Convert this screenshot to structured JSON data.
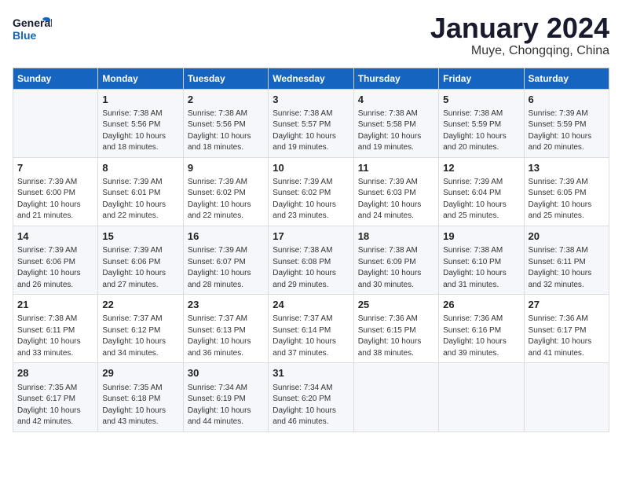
{
  "header": {
    "logo_general": "General",
    "logo_blue": "Blue",
    "month_title": "January 2024",
    "location": "Muye, Chongqing, China"
  },
  "weekdays": [
    "Sunday",
    "Monday",
    "Tuesday",
    "Wednesday",
    "Thursday",
    "Friday",
    "Saturday"
  ],
  "weeks": [
    [
      {
        "day": "",
        "sunrise": "",
        "sunset": "",
        "daylight": ""
      },
      {
        "day": "1",
        "sunrise": "Sunrise: 7:38 AM",
        "sunset": "Sunset: 5:56 PM",
        "daylight": "Daylight: 10 hours and 18 minutes."
      },
      {
        "day": "2",
        "sunrise": "Sunrise: 7:38 AM",
        "sunset": "Sunset: 5:56 PM",
        "daylight": "Daylight: 10 hours and 18 minutes."
      },
      {
        "day": "3",
        "sunrise": "Sunrise: 7:38 AM",
        "sunset": "Sunset: 5:57 PM",
        "daylight": "Daylight: 10 hours and 19 minutes."
      },
      {
        "day": "4",
        "sunrise": "Sunrise: 7:38 AM",
        "sunset": "Sunset: 5:58 PM",
        "daylight": "Daylight: 10 hours and 19 minutes."
      },
      {
        "day": "5",
        "sunrise": "Sunrise: 7:38 AM",
        "sunset": "Sunset: 5:59 PM",
        "daylight": "Daylight: 10 hours and 20 minutes."
      },
      {
        "day": "6",
        "sunrise": "Sunrise: 7:39 AM",
        "sunset": "Sunset: 5:59 PM",
        "daylight": "Daylight: 10 hours and 20 minutes."
      }
    ],
    [
      {
        "day": "7",
        "sunrise": "Sunrise: 7:39 AM",
        "sunset": "Sunset: 6:00 PM",
        "daylight": "Daylight: 10 hours and 21 minutes."
      },
      {
        "day": "8",
        "sunrise": "Sunrise: 7:39 AM",
        "sunset": "Sunset: 6:01 PM",
        "daylight": "Daylight: 10 hours and 22 minutes."
      },
      {
        "day": "9",
        "sunrise": "Sunrise: 7:39 AM",
        "sunset": "Sunset: 6:02 PM",
        "daylight": "Daylight: 10 hours and 22 minutes."
      },
      {
        "day": "10",
        "sunrise": "Sunrise: 7:39 AM",
        "sunset": "Sunset: 6:02 PM",
        "daylight": "Daylight: 10 hours and 23 minutes."
      },
      {
        "day": "11",
        "sunrise": "Sunrise: 7:39 AM",
        "sunset": "Sunset: 6:03 PM",
        "daylight": "Daylight: 10 hours and 24 minutes."
      },
      {
        "day": "12",
        "sunrise": "Sunrise: 7:39 AM",
        "sunset": "Sunset: 6:04 PM",
        "daylight": "Daylight: 10 hours and 25 minutes."
      },
      {
        "day": "13",
        "sunrise": "Sunrise: 7:39 AM",
        "sunset": "Sunset: 6:05 PM",
        "daylight": "Daylight: 10 hours and 25 minutes."
      }
    ],
    [
      {
        "day": "14",
        "sunrise": "Sunrise: 7:39 AM",
        "sunset": "Sunset: 6:06 PM",
        "daylight": "Daylight: 10 hours and 26 minutes."
      },
      {
        "day": "15",
        "sunrise": "Sunrise: 7:39 AM",
        "sunset": "Sunset: 6:06 PM",
        "daylight": "Daylight: 10 hours and 27 minutes."
      },
      {
        "day": "16",
        "sunrise": "Sunrise: 7:39 AM",
        "sunset": "Sunset: 6:07 PM",
        "daylight": "Daylight: 10 hours and 28 minutes."
      },
      {
        "day": "17",
        "sunrise": "Sunrise: 7:38 AM",
        "sunset": "Sunset: 6:08 PM",
        "daylight": "Daylight: 10 hours and 29 minutes."
      },
      {
        "day": "18",
        "sunrise": "Sunrise: 7:38 AM",
        "sunset": "Sunset: 6:09 PM",
        "daylight": "Daylight: 10 hours and 30 minutes."
      },
      {
        "day": "19",
        "sunrise": "Sunrise: 7:38 AM",
        "sunset": "Sunset: 6:10 PM",
        "daylight": "Daylight: 10 hours and 31 minutes."
      },
      {
        "day": "20",
        "sunrise": "Sunrise: 7:38 AM",
        "sunset": "Sunset: 6:11 PM",
        "daylight": "Daylight: 10 hours and 32 minutes."
      }
    ],
    [
      {
        "day": "21",
        "sunrise": "Sunrise: 7:38 AM",
        "sunset": "Sunset: 6:11 PM",
        "daylight": "Daylight: 10 hours and 33 minutes."
      },
      {
        "day": "22",
        "sunrise": "Sunrise: 7:37 AM",
        "sunset": "Sunset: 6:12 PM",
        "daylight": "Daylight: 10 hours and 34 minutes."
      },
      {
        "day": "23",
        "sunrise": "Sunrise: 7:37 AM",
        "sunset": "Sunset: 6:13 PM",
        "daylight": "Daylight: 10 hours and 36 minutes."
      },
      {
        "day": "24",
        "sunrise": "Sunrise: 7:37 AM",
        "sunset": "Sunset: 6:14 PM",
        "daylight": "Daylight: 10 hours and 37 minutes."
      },
      {
        "day": "25",
        "sunrise": "Sunrise: 7:36 AM",
        "sunset": "Sunset: 6:15 PM",
        "daylight": "Daylight: 10 hours and 38 minutes."
      },
      {
        "day": "26",
        "sunrise": "Sunrise: 7:36 AM",
        "sunset": "Sunset: 6:16 PM",
        "daylight": "Daylight: 10 hours and 39 minutes."
      },
      {
        "day": "27",
        "sunrise": "Sunrise: 7:36 AM",
        "sunset": "Sunset: 6:17 PM",
        "daylight": "Daylight: 10 hours and 41 minutes."
      }
    ],
    [
      {
        "day": "28",
        "sunrise": "Sunrise: 7:35 AM",
        "sunset": "Sunset: 6:17 PM",
        "daylight": "Daylight: 10 hours and 42 minutes."
      },
      {
        "day": "29",
        "sunrise": "Sunrise: 7:35 AM",
        "sunset": "Sunset: 6:18 PM",
        "daylight": "Daylight: 10 hours and 43 minutes."
      },
      {
        "day": "30",
        "sunrise": "Sunrise: 7:34 AM",
        "sunset": "Sunset: 6:19 PM",
        "daylight": "Daylight: 10 hours and 44 minutes."
      },
      {
        "day": "31",
        "sunrise": "Sunrise: 7:34 AM",
        "sunset": "Sunset: 6:20 PM",
        "daylight": "Daylight: 10 hours and 46 minutes."
      },
      {
        "day": "",
        "sunrise": "",
        "sunset": "",
        "daylight": ""
      },
      {
        "day": "",
        "sunrise": "",
        "sunset": "",
        "daylight": ""
      },
      {
        "day": "",
        "sunrise": "",
        "sunset": "",
        "daylight": ""
      }
    ]
  ]
}
